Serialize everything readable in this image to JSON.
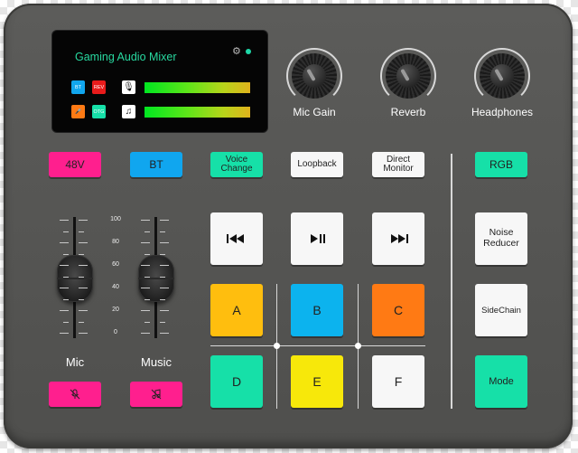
{
  "screen": {
    "title": "Gaming Audio Mixer",
    "icons": [
      "gear-icon",
      "status-dot"
    ],
    "row1": {
      "badge1": "BT",
      "badge2": "REV",
      "channel_icon": "🎙"
    },
    "row2": {
      "badge1": "🎤",
      "badge2": "OTG",
      "channel_icon": "♫"
    }
  },
  "knobs": [
    {
      "name": "mic-gain",
      "label": "Mic Gain"
    },
    {
      "name": "reverb",
      "label": "Reverb"
    },
    {
      "name": "headphones",
      "label": "Headphones"
    }
  ],
  "top_buttons": {
    "b48v": "48V",
    "bt": "BT",
    "voice_change_1": "Voice",
    "voice_change_2": "Change",
    "loopback": "Loopback",
    "direct_monitor_1": "Direct",
    "direct_monitor_2": "Monitor",
    "rgb": "RGB"
  },
  "scale": [
    "100",
    "80",
    "60",
    "40",
    "20",
    "0"
  ],
  "channels": {
    "mic": "Mic",
    "music": "Music"
  },
  "pads": {
    "prev": "⏮",
    "play": "⏯",
    "next": "⏭",
    "a": "A",
    "b": "B",
    "c": "C",
    "d": "D",
    "e": "E",
    "f": "F"
  },
  "right_buttons": {
    "noise_1": "Noise",
    "noise_2": "Reducer",
    "sidechain": "SideChain",
    "mode": "Mode"
  },
  "colors": {
    "pink": "#ff1f8e",
    "blue": "#10a6ef",
    "teal": "#16e0a8",
    "white": "#f7f7f7",
    "yellow": "#ffbe0e",
    "cyan": "#0cb3ee",
    "orange": "#ff7a14",
    "lime": "#f7e80a"
  }
}
